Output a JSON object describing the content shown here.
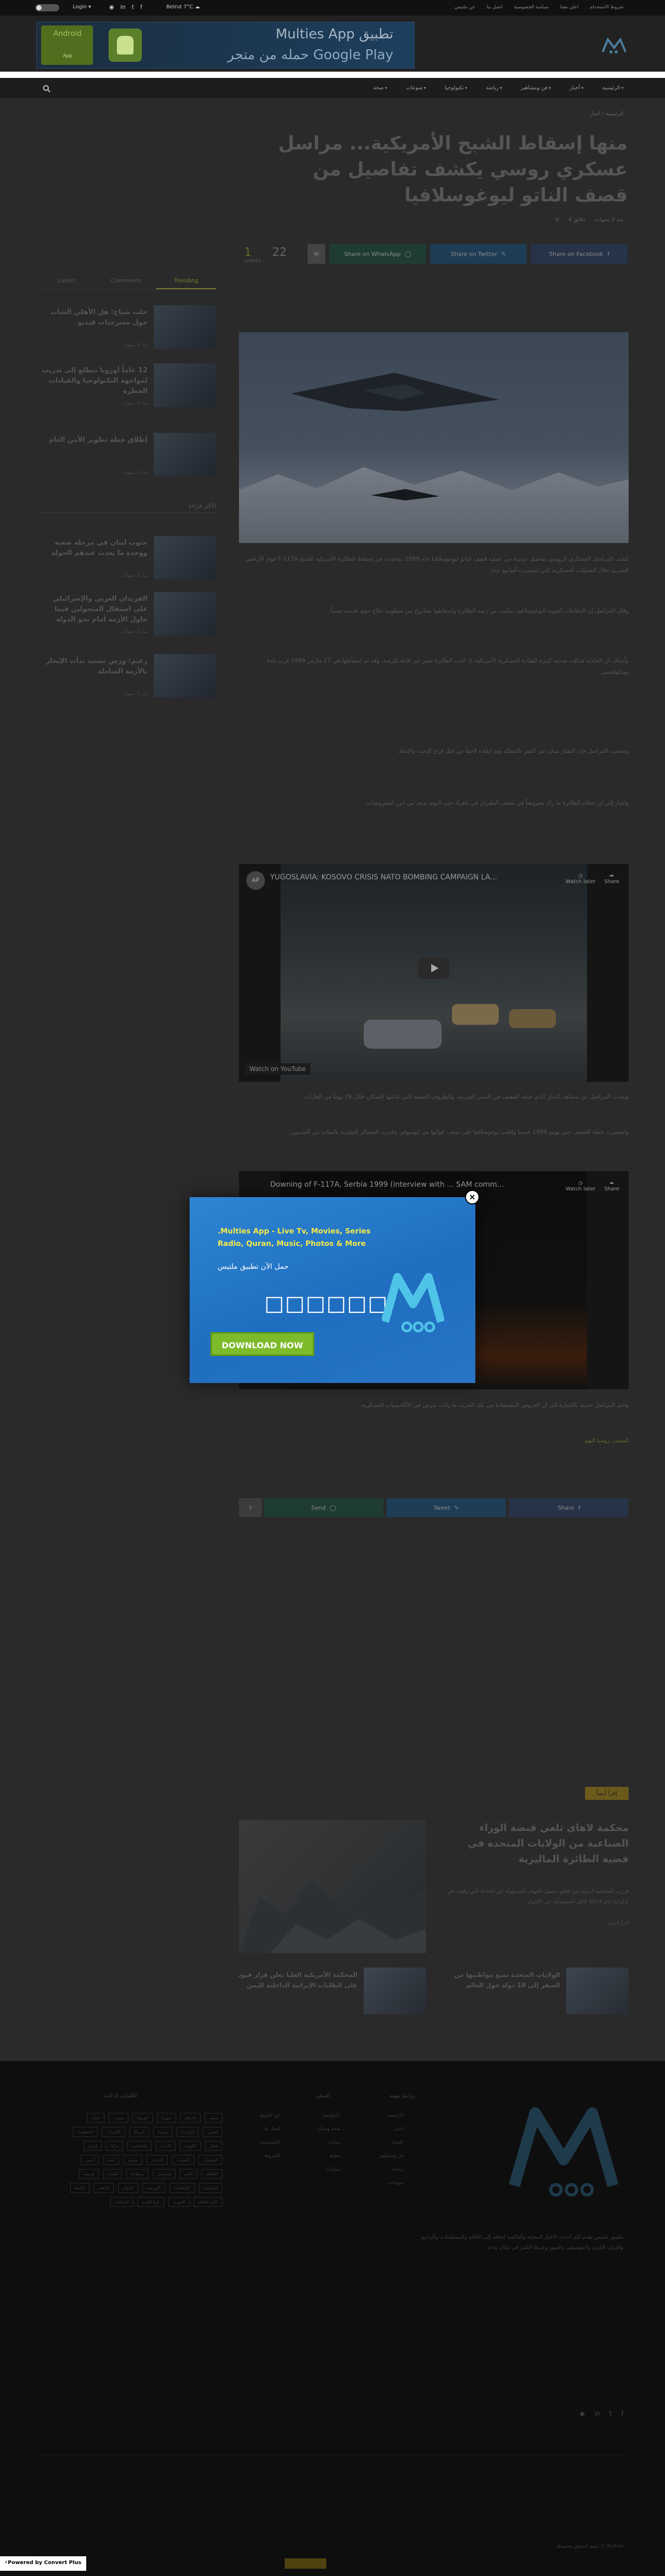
{
  "topbar": {
    "user": "Login ▾",
    "weather": "Beirut 7°C",
    "social": [
      "rss",
      "linkedin",
      "twitter",
      "facebook"
    ],
    "links": [
      "عن ملتيس",
      "اتصل بنا",
      "سياسة الخصوصية",
      "اعلن معنا",
      "شروط الاستخدام"
    ]
  },
  "ad": {
    "android_label": "Android",
    "android_text": "App",
    "title": "Multies App تطبيق",
    "subtitle": "حمله من متجر Google Play"
  },
  "nav": {
    "items": [
      "الرئيسية",
      "أخبار",
      "فن ومشاهير",
      "رياضة",
      "تكنولوجيا",
      "منوعات",
      "صحة"
    ]
  },
  "article": {
    "breadcrumb": "الرئيسية / أخبار",
    "title": "منها إسقاط الشبح الأمريكية... مراسل عسكري روسي يكشف تفاصيل من قصف الناتو ليوغوسلافيا",
    "meta": [
      "منذ 3 سنوات",
      "4 دقائق",
      "0",
      "22"
    ],
    "share": {
      "facebook": "Share on Facebook",
      "twitter": "Share on Twitter",
      "whatsapp": "Share on WhatsApp",
      "count_shares": "1",
      "count_views": "22",
      "count_label": "SHARES"
    },
    "paragraphs": [
      "كشف المراسل العسكري الروسي تفاصيل جديدة من عملية قصف الناتو ليوغوسلافيا عام 1999، وتحدث عن إسقاط الطائرة الأمريكية الشبح F-117A فوق الأراضي الصربية خلال العمليات العسكرية التي استمرت أسابيع عدة.",
      "وقال المراسل إن الدفاعات الجوية اليوغوسلافية تمكنت من رصد الطائرة وإسقاطها بصاروخ من منظومة دفاع جوي قديمة نسبياً.",
      "وأضاف أن الحادثة شكلت صدمة كبيرة للقيادة العسكرية الأمريكية، إذ كانت الطائرة تعتبر غير قابلة للرصد، وقد تم إسقاطها في 27 مارس 1999 قرب بلدة بودانوفتسي.",
      "وبحسب المراسل فإن الطيار تمكن من القفز بالمظلة وتم إنقاذه لاحقاً من قبل فرق البحث والإنقاذ.",
      "وأشار إلى أن حطام الطائرة ما زال معروضاً في متحف الطيران في بلغراد حتى اليوم، ويعد من أبرز المعروضات.",
      "وتحدث المراسل عن مشاهد الدمار الذي خلفه القصف في المدن الصربية، والظروف الصعبة التي عاشها السكان خلال 78 يوماً من الغارات.",
      "واستمرت حملة القصف حتى يونيو 1999 عندما وافقت يوغوسلافيا على سحب قواتها من كوسوفو، وقدرت الخسائر البشرية بالمئات من المدنيين.",
      "وختم المراسل حديثه بالإشارة إلى أن الدروس المستفادة من تلك الحرب ما زالت تدرس في الأكاديميات العسكرية."
    ],
    "video1": {
      "title": "YUGOSLAVIA: KOSOVO CRISIS NATO BOMBING CAMPAIGN LA...",
      "channel": "AP",
      "watch_later": "Watch later",
      "share": "Share",
      "watch_on": "Watch on YouTube"
    },
    "video2": {
      "title": "Downing of F-117A, Serbia 1999 (interview with ... SAM comm...",
      "channel": "",
      "watch_later": "Watch later",
      "share": "Share"
    },
    "source": "المصدر: روسيا اليوم",
    "share_bottom": {
      "facebook": "Share",
      "twitter": "Tweet",
      "whatsapp": "Send"
    }
  },
  "sidebar": {
    "tabs": [
      "Latest",
      "Comments",
      "Trending"
    ],
    "items": [
      {
        "title": "حلب شباخ: هل الأهلي الشاب حول مسرحيات فيديو",
        "date": "منذ 3 سنوات"
      },
      {
        "title": "12 عاماً أوروبا تتطلع إلى تدريب لمواجهة التكنولوجيا والقيادات الخطرة",
        "date": "منذ 3 سنوات"
      },
      {
        "title": "إطلاق خطة تطوير الأمن العام",
        "date": "منذ 3 سنوات"
      }
    ],
    "heading2": "الأكثر قراءة",
    "items2": [
      {
        "title": "جنوب لبنان في مرحلة صعبة ووحدة ما بعدت عندهم الجولة",
        "date": "منذ 3 سنوات"
      },
      {
        "title": "الفريدان العربي والإسرائيلي على استقال المتحولين فيما حاول الأزمة أمام نحو الدولة",
        "date": "منذ 3 سنوات"
      },
      {
        "title": "زعيم: ورس تنسيد بدأت الإنجاز بالأزمة الشاملة",
        "date": "منذ 3 سنوات"
      }
    ]
  },
  "related": {
    "heading": "إقرأ أيضاً",
    "main_title": "محكمة لاهاي تلغي قبضة الوراء الصناعية من الولايات المتحدة في قضية الطائرة الماليزية",
    "main_text": "قررت المحكمة الدولية في لاهاي تحميل الجهات المسؤولة عن الحادثة التي وقعت في أوكرانيا عام 2014 كامل المسؤولية عن الأضرار.",
    "main_more": "اقرأ المزيد",
    "small": [
      {
        "title": "الولايات المتحدة تمنع مواطنيها من السفر إلى 18 دولة حول العالم"
      },
      {
        "title": "المحكمة الأمريكية العليا تعلن قرار قيود على الطلبات الإيرانية الداخلية لليمن"
      }
    ]
  },
  "footer": {
    "about": "تطبيق ملتيس يقدم لكم أحدث الأخبار المحلية والعالمية إضافة إلى الأفلام والمسلسلات والراديو والقرآن الكريم والموسيقى والصور وغيرها الكثير في مكان واحد.",
    "col1_title": "روابط مهمة",
    "col1": [
      "الرئيسية",
      "أخبار",
      "اقتصاد",
      "فن ومشاهير",
      "رياضة",
      "منوعات"
    ],
    "col2_title": "أقسام",
    "col2": [
      "تكنولوجيا",
      "صحة وجمال",
      "سياحة",
      "مطبخ",
      "سيارات"
    ],
    "col3": [
      "عن الموقع",
      "اتصل بنا",
      "الخصوصية",
      "الشروط"
    ],
    "tags_title": "الكلمات الدلالية",
    "tags": [
      "لبنان",
      "بيروت",
      "كورونا",
      "سوريا",
      "العراق",
      "مصر",
      "السعودية",
      "الإمارات",
      "أمريكا",
      "روسيا",
      "أوكرانيا",
      "الصين",
      "إيران",
      "تركيا",
      "فلسطين",
      "الأردن",
      "الكويت",
      "قطر",
      "اليمن",
      "ليبيا",
      "تونس",
      "الجزائر",
      "المغرب",
      "السودان",
      "فرنسا",
      "ألمانيا",
      "بريطانيا",
      "إسرائيل",
      "الناتو",
      "الطاقة",
      "النفط",
      "الذهب",
      "الدولار",
      "البورصة",
      "الانتخابات",
      "الحكومة",
      "البرلمان",
      "كرة القدم",
      "الدوري",
      "كأس العالم"
    ],
    "copyright": "جميع الحقوق محفوظة © Multies",
    "social": [
      "rss",
      "linkedin",
      "twitter",
      "facebook"
    ]
  },
  "modal": {
    "title": ".Multies App - Live Tv, Movies, Series Radio, Quran, Music, Photos & More",
    "arabic": "حمل الآن تطبيق ملتيس",
    "squares": "□□□□□□",
    "button": "DOWNLOAD NOW",
    "close": "×"
  },
  "badge": "Powered by Convert Plus",
  "colors": {
    "modal_bg": "#1f6ec0",
    "modal_title": "#f4e94a",
    "download_btn": "#7dbb2a",
    "facebook": "#263348",
    "twitter": "#1e3d56",
    "whatsapp": "#1f3c33"
  }
}
